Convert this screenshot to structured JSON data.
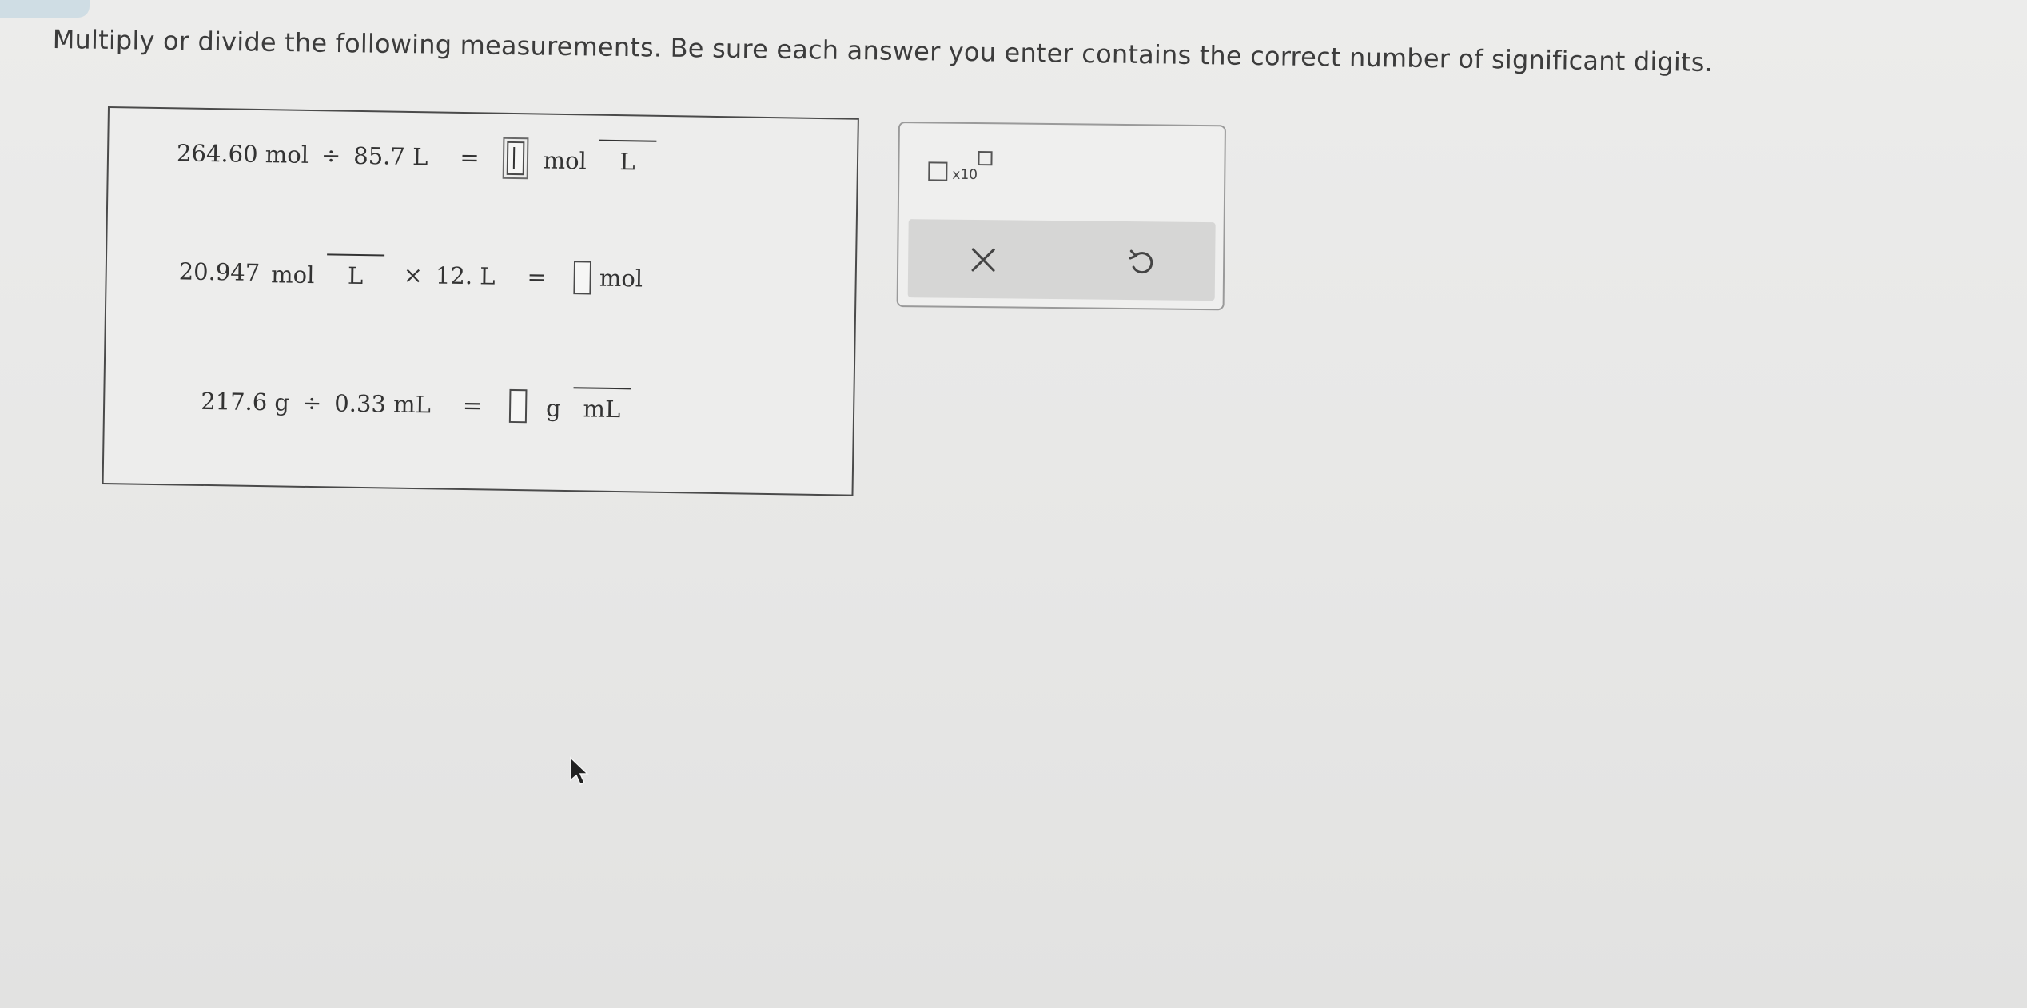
{
  "instructions": "Multiply or divide the following measurements. Be sure each answer you enter contains the correct number of significant digits.",
  "problems": [
    {
      "left": "264.60 mol",
      "operator": "÷",
      "right": "85.7 L",
      "equals": "=",
      "unit_numerator": "mol",
      "unit_denominator": "L"
    },
    {
      "value": "20.947",
      "value_unit_numerator": "mol",
      "value_unit_denominator": "L",
      "operator": "×",
      "right": "12. L",
      "equals": "=",
      "unit": "mol"
    },
    {
      "left": "217.6 g",
      "operator": "÷",
      "right": "0.33 mL",
      "equals": "=",
      "unit_numerator": "g",
      "unit_denominator": "mL"
    }
  ],
  "toolbar": {
    "sci_label": "x10",
    "clear_icon": "close-icon",
    "undo_icon": "undo-icon"
  },
  "colors": {
    "background": "#e9e9e8",
    "border": "#4a4a4a",
    "action_bar": "#d6d6d5"
  }
}
